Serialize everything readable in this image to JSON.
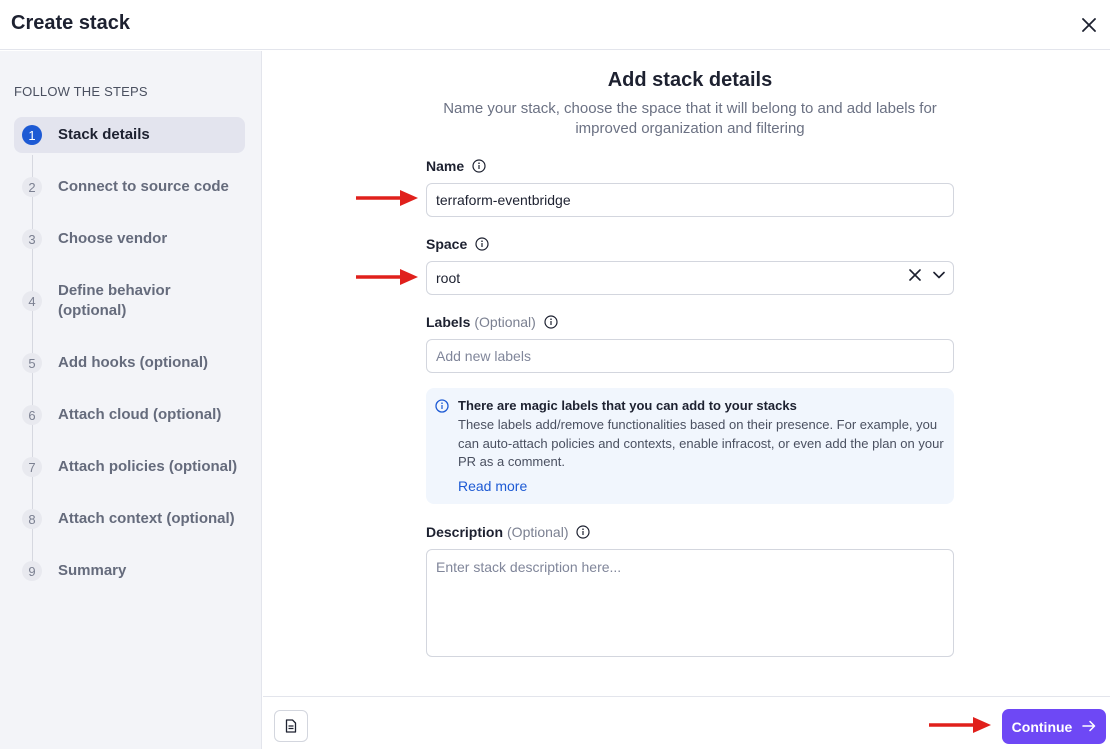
{
  "header": {
    "title": "Create stack"
  },
  "sidebar": {
    "steps_title": "FOLLOW THE STEPS",
    "steps": [
      {
        "num": "1",
        "label": "Stack details"
      },
      {
        "num": "2",
        "label": "Connect to source code"
      },
      {
        "num": "3",
        "label": "Choose vendor"
      },
      {
        "num": "4",
        "label": "Define behavior (optional)"
      },
      {
        "num": "5",
        "label": "Add hooks (optional)"
      },
      {
        "num": "6",
        "label": "Attach cloud (optional)"
      },
      {
        "num": "7",
        "label": "Attach policies (optional)"
      },
      {
        "num": "8",
        "label": "Attach context (optional)"
      },
      {
        "num": "9",
        "label": "Summary"
      }
    ]
  },
  "main": {
    "title": "Add stack details",
    "subtitle": "Name your stack, choose the space that it will belong to and add labels for improved organization and filtering",
    "name": {
      "label": "Name",
      "value": "terraform-eventbridge"
    },
    "space": {
      "label": "Space",
      "value": "root"
    },
    "labels": {
      "label": "Labels",
      "optional": "(Optional)",
      "placeholder": "Add new labels"
    },
    "callout": {
      "title": "There are magic labels that you can add to your stacks",
      "body": "These labels add/remove functionalities based on their presence. For example, you can auto-attach policies and contexts, enable infracost, or even add the plan on your PR as a comment.",
      "link": "Read more"
    },
    "description": {
      "label": "Description",
      "optional": "(Optional)",
      "placeholder": "Enter stack description here..."
    }
  },
  "footer": {
    "continue_label": "Continue"
  },
  "colors": {
    "accent": "#6e48f5",
    "active_step": "#1d5ad4",
    "annotation_arrow": "#e0201c",
    "link": "#1d5ad4"
  }
}
